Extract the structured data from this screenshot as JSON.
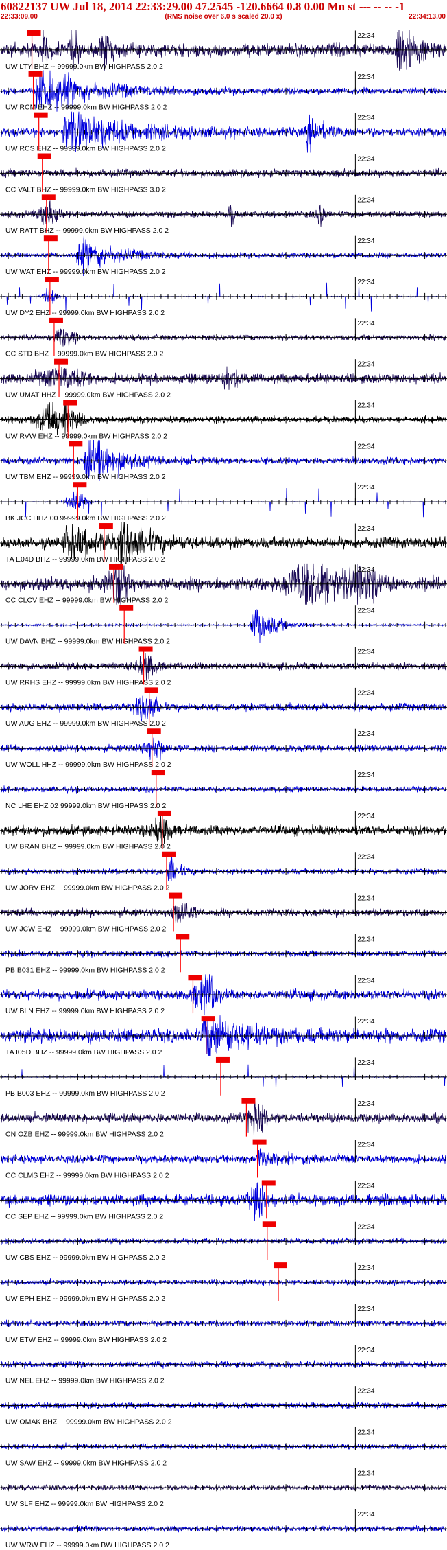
{
  "header": {
    "title": "60822137 UW Jul 18, 2014 22:33:29.00   47.2545 -120.6664  0.8 0.00 Mn st --- -- --   -1",
    "subtitle": "(RMS noise over 6.0 s scaled 20.0 x)",
    "start_time": "22:33:09.00",
    "end_time": "22:34:13.00",
    "minute_tick_label": "22:34"
  },
  "colors": {
    "header_text": "#cc0000",
    "trace_blue": "#0000dd",
    "trace_navy": "#1a0a55",
    "trace_black": "#000000",
    "axis": "#000000",
    "pick_line": "#ff0000",
    "pick_box": "#ee0000"
  },
  "chart_data": {
    "type": "line",
    "title": "60822137 UW Jul 18, 2014 22:33:29.00   47.2545 -120.6664  0.8 0.00 Mn st --- -- --   -1",
    "x_range": [
      "22:33:09.00",
      "22:34:13.00"
    ],
    "x_unit": "seconds",
    "x_duration_s": 64,
    "minute_mark": "22:34",
    "series": [
      {
        "label": "UW LTY BHZ -- 99999.0km BW  HIGHPASS  2.0  2",
        "color": "navy",
        "pick_s": 4.4,
        "style": "bursts",
        "amp": 0.3,
        "events": [
          [
            6,
            1.3,
            1
          ],
          [
            10,
            1.7,
            1
          ],
          [
            14.4,
            1.6,
            1.3
          ],
          [
            57,
            1.5,
            4
          ]
        ]
      },
      {
        "label": "UW RCM EHZ -- 99999.0km BW  HIGHPASS  2.0  2",
        "color": "blue",
        "pick_s": 4.6,
        "style": "quake",
        "amp": 0.15,
        "events": [
          [
            5,
            1.1,
            12
          ]
        ]
      },
      {
        "label": "UW RCS EHZ -- 99999.0km BW  HIGHPASS  2.0  2",
        "color": "blue",
        "pick_s": 5.4,
        "style": "quake",
        "amp": 0.2,
        "events": [
          [
            9,
            1.0,
            14
          ],
          [
            44,
            0.9,
            3
          ]
        ]
      },
      {
        "label": "CC VALT BHZ -- 99999.0km BW  HIGHPASS  3.0  2",
        "color": "navy",
        "pick_s": 5.9,
        "style": "noise",
        "amp": 0.18,
        "events": []
      },
      {
        "label": "UW RATT BHZ -- 99999.0km BW  HIGHPASS  2.0  2",
        "color": "navy",
        "pick_s": 6.5,
        "style": "noise",
        "amp": 0.14,
        "events": [
          [
            7,
            0.5,
            3
          ],
          [
            33,
            0.4,
            1
          ],
          [
            46,
            0.7,
            1
          ]
        ]
      },
      {
        "label": "UW WAT EHZ -- 99999.0km BW  HIGHPASS  2.0  2",
        "color": "blue",
        "pick_s": 6.8,
        "style": "quake",
        "amp": 0.12,
        "events": [
          [
            11,
            0.9,
            8
          ]
        ]
      },
      {
        "label": "UW DY2 EHZ -- 99999.0km BW  HIGHPASS  2.0  2",
        "color": "blue",
        "pick_s": 7.0,
        "style": "spiky",
        "amp": 0.05,
        "events": [
          [
            7,
            0.4,
            2
          ]
        ]
      },
      {
        "label": "CC STD BHZ -- 99999.0km BW  HIGHPASS  2.0  2",
        "color": "navy",
        "pick_s": 7.6,
        "style": "noise",
        "amp": 0.12,
        "events": [
          [
            9,
            0.4,
            3
          ]
        ]
      },
      {
        "label": "UW UMAT HHZ -- 99999.0km BW  HIGHPASS  2.0  2",
        "color": "navy",
        "pick_s": 8.3,
        "style": "noise",
        "amp": 0.22,
        "events": [
          [
            9,
            0.4,
            6
          ],
          [
            33,
            0.4,
            3
          ]
        ]
      },
      {
        "label": "UW RVW EHZ -- 99999.0km BW  HIGHPASS  2.0  2",
        "color": "black",
        "pick_s": 9.6,
        "style": "noise",
        "amp": 0.15,
        "events": [
          [
            8,
            0.8,
            5
          ]
        ]
      },
      {
        "label": "UW TBM EHZ -- 99999.0km BW  HIGHPASS  2.0  2",
        "color": "blue",
        "pick_s": 10.4,
        "style": "quake",
        "amp": 0.15,
        "events": [
          [
            12,
            1.4,
            7
          ]
        ]
      },
      {
        "label": "BK JCC HHZ 00 99999.0km BW  HIGHPASS  2.0  2",
        "color": "blue",
        "pick_s": 11.0,
        "style": "spiky",
        "amp": 0.04,
        "events": [
          [
            11,
            0.5,
            3
          ]
        ]
      },
      {
        "label": "TA E04D BHZ -- 99999.0km BW  HIGHPASS  2.0  2",
        "color": "black",
        "pick_s": 14.8,
        "style": "quake",
        "amp": 0.25,
        "events": [
          [
            9,
            0.7,
            8
          ],
          [
            17,
            1.1,
            6
          ]
        ]
      },
      {
        "label": "CC CLCV EHZ -- 99999.0km BW  HIGHPASS  2.0  2",
        "color": "navy",
        "pick_s": 16.2,
        "style": "noise",
        "amp": 0.3,
        "events": [
          [
            17,
            0.9,
            3
          ],
          [
            45,
            1.2,
            6
          ],
          [
            52,
            0.8,
            5
          ]
        ]
      },
      {
        "label": "UW DAVN BHZ -- 99999.0km BW  HIGHPASS  2.0  2",
        "color": "blue",
        "pick_s": 17.7,
        "style": "quake",
        "amp": 0.04,
        "events": [
          [
            36,
            1.0,
            5
          ]
        ]
      },
      {
        "label": "UW RRHS EHZ -- 99999.0km BW  HIGHPASS  2.0  2",
        "color": "navy",
        "pick_s": 20.5,
        "style": "noise",
        "amp": 0.15,
        "events": [
          [
            21,
            0.5,
            3
          ]
        ]
      },
      {
        "label": "UW AUG EHZ -- 99999.0km BW  HIGHPASS  2.0  2",
        "color": "blue",
        "pick_s": 21.3,
        "style": "noise",
        "amp": 0.18,
        "events": [
          [
            21,
            0.6,
            3
          ]
        ]
      },
      {
        "label": "UW WOLL HHZ -- 99999.0km BW  HIGHPASS  2.0  2",
        "color": "blue",
        "pick_s": 21.7,
        "style": "noise",
        "amp": 0.15,
        "events": [
          [
            22,
            0.5,
            3
          ]
        ]
      },
      {
        "label": "NC LHE EHZ 02 99999.0km BW  HIGHPASS  2.0  2",
        "color": "blue",
        "pick_s": 22.3,
        "style": "noise",
        "amp": 0.12,
        "events": []
      },
      {
        "label": "UW BRAN BHZ -- 99999.0km BW  HIGHPASS  2.0  2",
        "color": "black",
        "pick_s": 23.2,
        "style": "noise",
        "amp": 0.22,
        "events": [
          [
            23,
            0.5,
            3
          ]
        ]
      },
      {
        "label": "UW JORV EHZ -- 99999.0km BW  HIGHPASS  2.0  2",
        "color": "blue",
        "pick_s": 23.8,
        "style": "quake",
        "amp": 0.12,
        "events": [
          [
            24,
            0.9,
            2
          ]
        ]
      },
      {
        "label": "UW JCW EHZ -- 99999.0km BW  HIGHPASS  2.0  2",
        "color": "navy",
        "pick_s": 24.8,
        "style": "noise",
        "amp": 0.18,
        "events": [
          [
            26,
            0.5,
            3
          ]
        ]
      },
      {
        "label": "PB B031 EHZ -- 99999.0km BW  HIGHPASS  2.0  2",
        "color": "blue",
        "pick_s": 25.8,
        "style": "noise",
        "amp": 0.12,
        "events": []
      },
      {
        "label": "UW BLN EHZ -- 99999.0km BW  HIGHPASS  2.0  2",
        "color": "blue",
        "pick_s": 27.6,
        "style": "noise",
        "amp": 0.22,
        "events": [
          [
            29.5,
            1.0,
            3
          ]
        ]
      },
      {
        "label": "TA I05D BHZ -- 99999.0km BW  HIGHPASS  2.0  2",
        "color": "blue",
        "pick_s": 29.5,
        "style": "quake",
        "amp": 0.3,
        "events": [
          [
            29,
            1.1,
            9
          ]
        ]
      },
      {
        "label": "PB B003 EHZ -- 99999.0km BW  HIGHPASS  2.0  2",
        "color": "blue",
        "pick_s": 31.6,
        "style": "spiky",
        "amp": 0.05,
        "events": []
      },
      {
        "label": "CN OZB EHZ -- 99999.0km BW  HIGHPASS  2.0  2",
        "color": "navy",
        "pick_s": 35.3,
        "style": "noise",
        "amp": 0.2,
        "events": [
          [
            37,
            0.7,
            3
          ]
        ]
      },
      {
        "label": "CC CLMS EHZ -- 99999.0km BW  HIGHPASS  2.0  2",
        "color": "blue",
        "pick_s": 36.9,
        "style": "quake",
        "amp": 0.18,
        "events": [
          [
            37,
            0.5,
            4
          ]
        ]
      },
      {
        "label": "CC SEP EHZ -- 99999.0km BW  HIGHPASS  2.0  2",
        "color": "blue",
        "pick_s": 38.2,
        "style": "noise",
        "amp": 0.25,
        "events": [
          [
            37,
            1.0,
            2
          ]
        ]
      },
      {
        "label": "UW CBS EHZ -- 99999.0km BW  HIGHPASS  2.0  2",
        "color": "blue",
        "pick_s": 38.3,
        "style": "noise",
        "amp": 0.12,
        "events": []
      },
      {
        "label": "UW EPH EHZ -- 99999.0km BW  HIGHPASS  2.0  2",
        "color": "blue",
        "pick_s": 39.9,
        "style": "noise",
        "amp": 0.12,
        "events": []
      },
      {
        "label": "UW ETW EHZ -- 99999.0km BW  HIGHPASS  2.0  2",
        "color": "blue",
        "pick_s": null,
        "style": "noise",
        "amp": 0.12,
        "events": []
      },
      {
        "label": "UW NEL EHZ -- 99999.0km BW  HIGHPASS  2.0  2",
        "color": "blue",
        "pick_s": null,
        "style": "noise",
        "amp": 0.14,
        "events": []
      },
      {
        "label": "UW OMAK BHZ -- 99999.0km BW  HIGHPASS  2.0  2",
        "color": "blue",
        "pick_s": null,
        "style": "noise",
        "amp": 0.13,
        "events": []
      },
      {
        "label": "UW SAW EHZ -- 99999.0km BW  HIGHPASS  2.0  2",
        "color": "blue",
        "pick_s": null,
        "style": "noise",
        "amp": 0.12,
        "events": []
      },
      {
        "label": "UW SLF EHZ -- 99999.0km BW  HIGHPASS  2.0  2",
        "color": "navy",
        "pick_s": null,
        "style": "noise",
        "amp": 0.1,
        "events": []
      },
      {
        "label": "UW WRW EHZ -- 99999.0km BW  HIGHPASS  2.0  2",
        "color": "blue",
        "pick_s": null,
        "style": "noise",
        "amp": 0.12,
        "events": []
      }
    ]
  }
}
